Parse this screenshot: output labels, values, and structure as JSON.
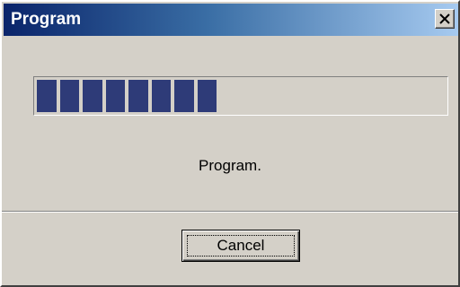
{
  "window": {
    "title": "Program",
    "close_glyph": "close-icon"
  },
  "progress": {
    "filled_blocks": 8,
    "fraction": 0.39,
    "fill_color": "#2e3b78"
  },
  "status": {
    "text": "Program."
  },
  "buttons": {
    "cancel_label": "Cancel"
  },
  "colors": {
    "titlebar_start": "#0a246a",
    "titlebar_end": "#a6caf0",
    "face": "#d4d0c8"
  }
}
